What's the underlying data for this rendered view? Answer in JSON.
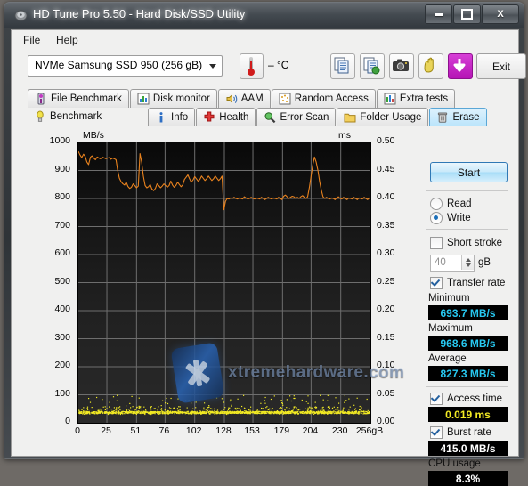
{
  "window": {
    "title": "HD Tune Pro 5.50 - Hard Disk/SSD Utility",
    "minimize_label": "–",
    "maximize_label": "□",
    "close_label": "X"
  },
  "menu": {
    "items": [
      "File",
      "Help"
    ]
  },
  "toolbar": {
    "drive": "NVMe   Samsung SSD 950 (256 gB)",
    "temperature": "– °C",
    "buttons": [
      "copy-icon",
      "copy-to-file-icon",
      "screenshot-icon",
      "hand-icon",
      "download-icon"
    ],
    "exit_label": "Exit"
  },
  "tabs": {
    "row1": [
      {
        "label": "File Benchmark",
        "icon": "file-benchmark-icon",
        "state": "normal"
      },
      {
        "label": "Disk monitor",
        "icon": "disk-monitor-icon",
        "state": "normal"
      },
      {
        "label": "AAM",
        "icon": "aam-speaker-icon",
        "state": "normal"
      },
      {
        "label": "Random Access",
        "icon": "random-access-icon",
        "state": "normal"
      },
      {
        "label": "Extra tests",
        "icon": "extra-tests-icon",
        "state": "normal"
      }
    ],
    "row2": [
      {
        "label": "Benchmark",
        "icon": "benchmark-bulb-icon",
        "state": "active"
      },
      {
        "label": "Info",
        "icon": "info-icon",
        "state": "normal"
      },
      {
        "label": "Health",
        "icon": "health-cross-icon",
        "state": "normal"
      },
      {
        "label": "Error Scan",
        "icon": "error-scan-magnifier-icon",
        "state": "normal"
      },
      {
        "label": "Folder Usage",
        "icon": "folder-usage-icon",
        "state": "normal"
      },
      {
        "label": "Erase",
        "icon": "erase-trash-icon",
        "state": "hot"
      }
    ]
  },
  "controls": {
    "start_label": "Start",
    "mode_options": [
      "Read",
      "Write"
    ],
    "mode_selected": "Write",
    "short_stroke_label": "Short stroke",
    "short_stroke_checked": false,
    "short_stroke_value": "40",
    "short_stroke_unit": "gB",
    "transfer_rate_label": "Transfer rate",
    "transfer_rate_checked": true,
    "access_time_label": "Access time",
    "access_time_checked": true,
    "burst_rate_label": "Burst rate",
    "burst_rate_checked": true,
    "results": {
      "minimum_label": "Minimum",
      "minimum_value": "693.7 MB/s",
      "maximum_label": "Maximum",
      "maximum_value": "968.6 MB/s",
      "average_label": "Average",
      "average_value": "827.3 MB/s",
      "access_time_value": "0.019 ms",
      "burst_rate_value": "415.0 MB/s",
      "cpu_usage_label": "CPU usage",
      "cpu_usage_value": "8.3%"
    }
  },
  "watermark": {
    "text": "xtremehardware.com"
  },
  "chart_data": {
    "type": "line",
    "title": "",
    "xlabel": "256gB",
    "ylabel": "MB/s",
    "y2label": "ms",
    "grid": true,
    "legend": "none",
    "xlim": [
      0,
      256
    ],
    "ylim": [
      0,
      1000
    ],
    "y2lim": [
      0,
      0.5
    ],
    "xticks": [
      0,
      25,
      51,
      76,
      102,
      128,
      153,
      179,
      204,
      230,
      256
    ],
    "xticklabels": [
      "0",
      "25",
      "51",
      "76",
      "102",
      "128",
      "153",
      "179",
      "204",
      "230",
      "256gB"
    ],
    "yticks": [
      0,
      100,
      200,
      300,
      400,
      500,
      600,
      700,
      800,
      900,
      1000
    ],
    "yticklabels": [
      "0",
      "100",
      "200",
      "300",
      "400",
      "500",
      "600",
      "700",
      "800",
      "900",
      "1000"
    ],
    "y2ticks": [
      0.0,
      0.05,
      0.1,
      0.15,
      0.2,
      0.25,
      0.3,
      0.35,
      0.4,
      0.45,
      0.5
    ],
    "y2ticklabels": [
      "0.00",
      "0.05",
      "0.10",
      "0.15",
      "0.20",
      "0.25",
      "0.30",
      "0.35",
      "0.40",
      "0.45",
      "0.50"
    ],
    "series": [
      {
        "name": "Transfer rate",
        "color": "#e8821e",
        "axis": "left",
        "unit": "MB/s",
        "x": [
          0,
          1.5,
          3,
          4.5,
          6,
          7.5,
          9,
          10.5,
          12,
          13.5,
          15,
          16.5,
          18,
          19.5,
          21,
          22.5,
          24,
          25.5,
          27,
          28.5,
          30,
          31.5,
          33,
          34.5,
          36,
          37.5,
          39,
          40.5,
          42,
          43.5,
          45,
          46.5,
          48,
          49.5,
          51,
          52.5,
          54,
          55.5,
          57,
          58.5,
          60,
          61.5,
          63,
          64.5,
          66,
          67.5,
          69,
          70.5,
          72,
          73.5,
          75,
          76.5,
          78,
          79.5,
          81,
          82.5,
          84,
          85.5,
          87,
          88.5,
          90,
          91.5,
          93,
          94.5,
          96,
          97.5,
          99,
          100.5,
          102,
          103.5,
          105,
          106.5,
          108,
          109.5,
          111,
          112.5,
          114,
          115.5,
          117,
          118.5,
          120,
          121.5,
          123,
          124.5,
          126,
          127.5,
          129,
          130.5,
          132,
          133.5,
          135,
          136.5,
          138,
          139.5,
          141,
          142.5,
          144,
          145.5,
          147,
          148.5,
          150,
          151.5,
          153,
          154.5,
          156,
          157.5,
          159,
          160.5,
          162,
          163.5,
          165,
          166.5,
          168,
          169.5,
          171,
          172.5,
          174,
          175.5,
          177,
          178.5,
          180,
          181.5,
          183,
          184.5,
          186,
          187.5,
          189,
          190.5,
          192,
          193.5,
          195,
          196.5,
          198,
          199.5,
          201,
          202.5,
          204,
          205.5,
          207,
          208.5,
          210,
          211.5,
          213,
          214.5,
          216,
          217.5,
          219,
          220.5,
          222,
          223.5,
          225,
          226.5,
          228,
          229.5,
          231,
          232.5,
          234,
          235.5,
          237,
          238.5,
          240,
          241.5,
          243,
          244.5,
          246,
          247.5,
          249,
          250.5,
          252,
          253.5,
          255,
          256
        ],
        "y": [
          968,
          955,
          946,
          958,
          950,
          930,
          921,
          947,
          952,
          944,
          938,
          948,
          944,
          942,
          947,
          945,
          942,
          944,
          946,
          940,
          944,
          942,
          938,
          900,
          872,
          860,
          852,
          848,
          858,
          843,
          836,
          840,
          852,
          846,
          838,
          844,
          960,
          930,
          880,
          846,
          838,
          842,
          850,
          834,
          828,
          836,
          852,
          846,
          838,
          844,
          852,
          846,
          840,
          846,
          862,
          848,
          840,
          846,
          858,
          850,
          842,
          848,
          868,
          876,
          884,
          870,
          858,
          866,
          878,
          870,
          862,
          868,
          880,
          872,
          864,
          870,
          880,
          872,
          864,
          870,
          880,
          872,
          864,
          870,
          880,
          760,
          790,
          800,
          798,
          802,
          800,
          804,
          800,
          798,
          802,
          800,
          798,
          806,
          802,
          798,
          800,
          804,
          800,
          798,
          802,
          800,
          798,
          804,
          800,
          796,
          800,
          804,
          800,
          798,
          802,
          800,
          798,
          804,
          800,
          796,
          808,
          812,
          806,
          800,
          804,
          808,
          806,
          800,
          804,
          800,
          806,
          810,
          804,
          800,
          806,
          840,
          880,
          920,
          948,
          930,
          900,
          860,
          830,
          806,
          800,
          804,
          800,
          798,
          802,
          800,
          796,
          802,
          806,
          800,
          798,
          804,
          800,
          796,
          802,
          800,
          798,
          804,
          800,
          796,
          802,
          800,
          798,
          804,
          800,
          796,
          802,
          800,
          798,
          804,
          800,
          796,
          802,
          800,
          798,
          804,
          800,
          796,
          802,
          800,
          798,
          804,
          800,
          796,
          802,
          800,
          798,
          804,
          800,
          806,
          810,
          804,
          800,
          806,
          810,
          806,
          800,
          804,
          808,
          802,
          798,
          804,
          800,
          796,
          800,
          804,
          800,
          798,
          802,
          800,
          796,
          802,
          806,
          800,
          798,
          804,
          800,
          796,
          800,
          804,
          800,
          798,
          802,
          806,
          800,
          804,
          808,
          802,
          798,
          804,
          800,
          796,
          800,
          804,
          800,
          806,
          810,
          804,
          800,
          806,
          812,
          808,
          804,
          800,
          796,
          790,
          780,
          770,
          760,
          748,
          730,
          715,
          700,
          708,
          722,
          716,
          710,
          718,
          712,
          706,
          714,
          720,
          714,
          708,
          716,
          712,
          706,
          714,
          718,
          712,
          708,
          716,
          712,
          706,
          714,
          718,
          712
        ]
      },
      {
        "name": "Access time",
        "color": "#f2ea24",
        "axis": "right",
        "unit": "ms",
        "marker": "dot",
        "baseline": 0.019,
        "scatter_band": [
          0.016,
          0.03
        ],
        "outlier_max": 0.05
      }
    ]
  }
}
